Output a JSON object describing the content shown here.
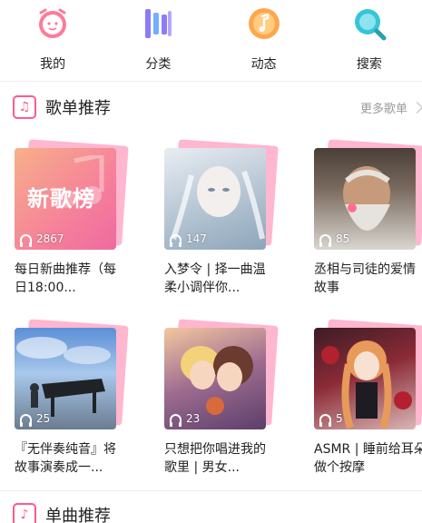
{
  "nav": {
    "items": [
      {
        "label": "我的",
        "icon": "alarm-clock-icon",
        "color": "#ff6f91"
      },
      {
        "label": "分类",
        "icon": "category-bars-icon",
        "color": "#8b7cf6"
      },
      {
        "label": "动态",
        "icon": "music-note-icon",
        "color": "#ffa64d"
      },
      {
        "label": "搜索",
        "icon": "search-icon",
        "color": "#35c5d8"
      }
    ]
  },
  "playlist_section": {
    "title": "歌单推荐",
    "more": "更多歌单",
    "cards": [
      {
        "count": "2867",
        "title": "每日新曲推荐（每日18:00...",
        "cover_text": "新歌榜"
      },
      {
        "count": "147",
        "title": "入梦令 | 择一曲温柔小调伴你..."
      },
      {
        "count": "85",
        "title": "丞相与司徒的爱情故事"
      },
      {
        "count": "25",
        "title": "『无伴奏纯音』将故事演奏成一..."
      },
      {
        "count": "23",
        "title": "只想把你唱进我的歌里 | 男女..."
      },
      {
        "count": "5",
        "title": "ASMR | 睡前给耳朵做个按摩"
      }
    ]
  },
  "single_section": {
    "title": "单曲推荐"
  },
  "colors": {
    "accent": "#ff5a8a",
    "card_back": "#ffb6cf"
  }
}
